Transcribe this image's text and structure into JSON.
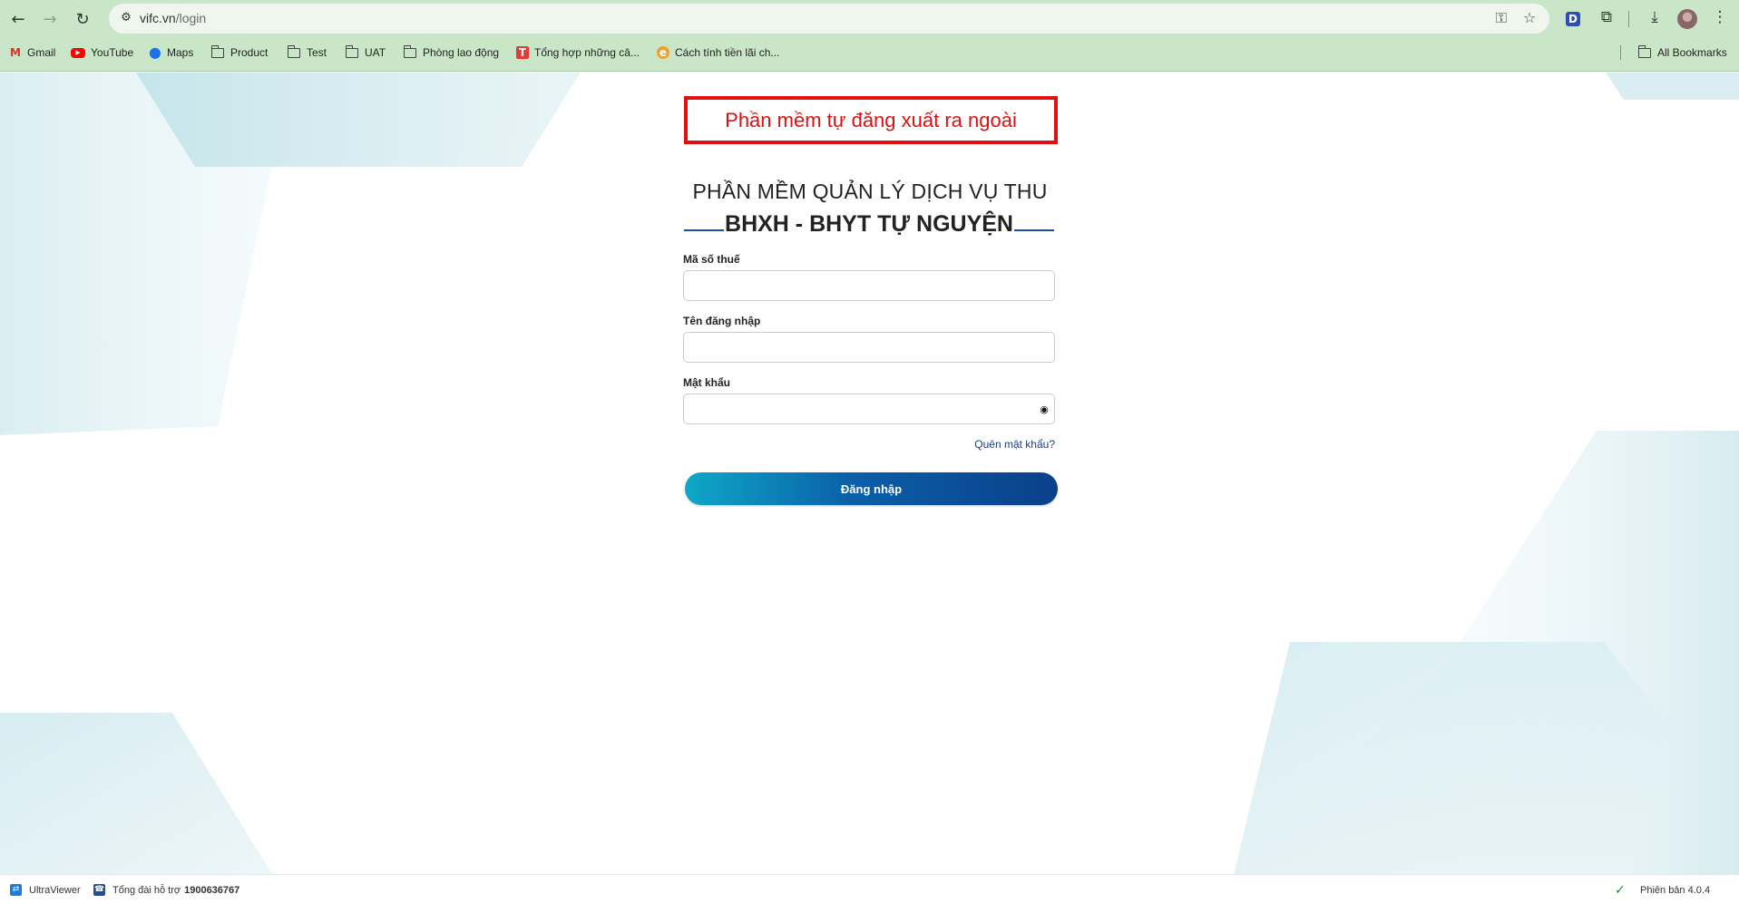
{
  "browser": {
    "url_host": "vifc.vn",
    "url_path": "/login",
    "bookmarks": [
      {
        "label": "Gmail",
        "icon": "gmail-icon"
      },
      {
        "label": "YouTube",
        "icon": "youtube-icon"
      },
      {
        "label": "Maps",
        "icon": "maps-icon"
      },
      {
        "label": "Product",
        "icon": "folder-icon"
      },
      {
        "label": "Test",
        "icon": "folder-icon"
      },
      {
        "label": "UAT",
        "icon": "folder-icon"
      },
      {
        "label": "Phòng lao động",
        "icon": "folder-icon"
      },
      {
        "label": "Tổng hợp những câ...",
        "icon": "t-site-icon"
      },
      {
        "label": "Cách tính tiền lãi ch...",
        "icon": "e-site-icon"
      }
    ],
    "all_bookmarks": "All Bookmarks",
    "extension_letter": "D"
  },
  "page": {
    "alert_message": "Phần mềm tự đăng xuất ra ngoài",
    "title_line1": "PHẦN MỀM QUẢN LÝ DỊCH VỤ THU",
    "title_line2": "BHXH - BHYT TỰ NGUYỆN",
    "fields": {
      "tax_code_label": "Mã số thuế",
      "tax_code_value": "",
      "username_label": "Tên đăng nhập",
      "username_value": "",
      "password_label": "Mật khẩu",
      "password_value": ""
    },
    "forgot_password": "Quên mật khẩu?",
    "login_button": "Đăng nhập"
  },
  "footer": {
    "ultraviewer": "UltraViewer",
    "support_label": "Tổng đài hỗ trợ",
    "support_phone": "1900636767",
    "version": "Phiên bản 4.0.4"
  },
  "colors": {
    "chrome_bg": "#c9e6c9",
    "alert_red": "#e01010",
    "accent_blue": "#0b3f8a",
    "accent_cyan": "#0ea8c8"
  }
}
